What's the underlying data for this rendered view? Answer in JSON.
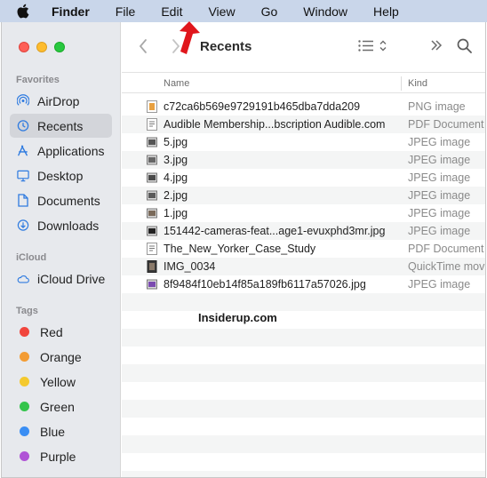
{
  "menubar": {
    "app": "Finder",
    "items": [
      "File",
      "Edit",
      "View",
      "Go",
      "Window",
      "Help"
    ]
  },
  "toolbar": {
    "title": "Recents"
  },
  "sidebar": {
    "favorites_header": "Favorites",
    "favorites": [
      {
        "label": "AirDrop",
        "icon": "airdrop-icon"
      },
      {
        "label": "Recents",
        "icon": "clock-icon"
      },
      {
        "label": "Applications",
        "icon": "applications-icon"
      },
      {
        "label": "Desktop",
        "icon": "desktop-icon"
      },
      {
        "label": "Documents",
        "icon": "document-icon"
      },
      {
        "label": "Downloads",
        "icon": "download-icon"
      }
    ],
    "icloud_header": "iCloud",
    "icloud": [
      {
        "label": "iCloud Drive",
        "icon": "cloud-icon"
      }
    ],
    "tags_header": "Tags",
    "tags": [
      {
        "label": "Red",
        "color": "#f1453d"
      },
      {
        "label": "Orange",
        "color": "#f39c34"
      },
      {
        "label": "Yellow",
        "color": "#f4c92e"
      },
      {
        "label": "Green",
        "color": "#34c44b"
      },
      {
        "label": "Blue",
        "color": "#3a8ef4"
      },
      {
        "label": "Purple",
        "color": "#b053d6"
      }
    ]
  },
  "list": {
    "headers": {
      "name": "Name",
      "kind": "Kind"
    },
    "rows": [
      {
        "name": "c72ca6b569e9729191b465dba7dda209",
        "kind": "PNG image"
      },
      {
        "name": "Audible Membership...bscription  Audible.com",
        "kind": "PDF Document"
      },
      {
        "name": "5.jpg",
        "kind": "JPEG image"
      },
      {
        "name": "3.jpg",
        "kind": "JPEG image"
      },
      {
        "name": "4.jpg",
        "kind": "JPEG image"
      },
      {
        "name": "2.jpg",
        "kind": "JPEG image"
      },
      {
        "name": "1.jpg",
        "kind": "JPEG image"
      },
      {
        "name": "151442-cameras-feat...age1-evuxphd3mr.jpg",
        "kind": "JPEG image"
      },
      {
        "name": "The_New_Yorker_Case_Study",
        "kind": "PDF Document"
      },
      {
        "name": "IMG_0034",
        "kind": "QuickTime movi"
      },
      {
        "name": "8f9484f10eb14f85a189fb6117a57026.jpg",
        "kind": "JPEG image"
      }
    ]
  },
  "watermark": "Insiderup.com"
}
